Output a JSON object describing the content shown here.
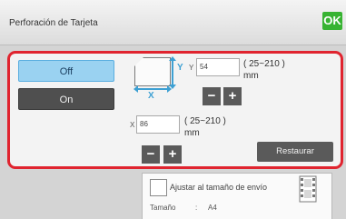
{
  "header": {
    "title": "Perforación de Tarjeta",
    "ok_label": "OK"
  },
  "mode": {
    "off_label": "Off",
    "on_label": "On",
    "selected": "Off"
  },
  "size": {
    "y": {
      "axis": "Y",
      "label": "Y",
      "value": "54",
      "range": "( 25~210 )",
      "unit": "mm",
      "minus": "−",
      "plus": "+"
    },
    "x": {
      "axis": "X",
      "label": "X",
      "value": "86",
      "range": "( 25~210 )",
      "unit": "mm",
      "minus": "−",
      "plus": "+"
    }
  },
  "restore_label": "Restaurar",
  "fit": {
    "label": "Ajustar al tamaño de envío",
    "checked": false
  },
  "paper": {
    "label": "Tamaño",
    "colon": ":",
    "value": "A4"
  },
  "colors": {
    "accent_border": "#e0242f",
    "ok_green": "#37b332",
    "selected_blue": "#9ad2f1",
    "axis_blue": "#3da0d3"
  }
}
